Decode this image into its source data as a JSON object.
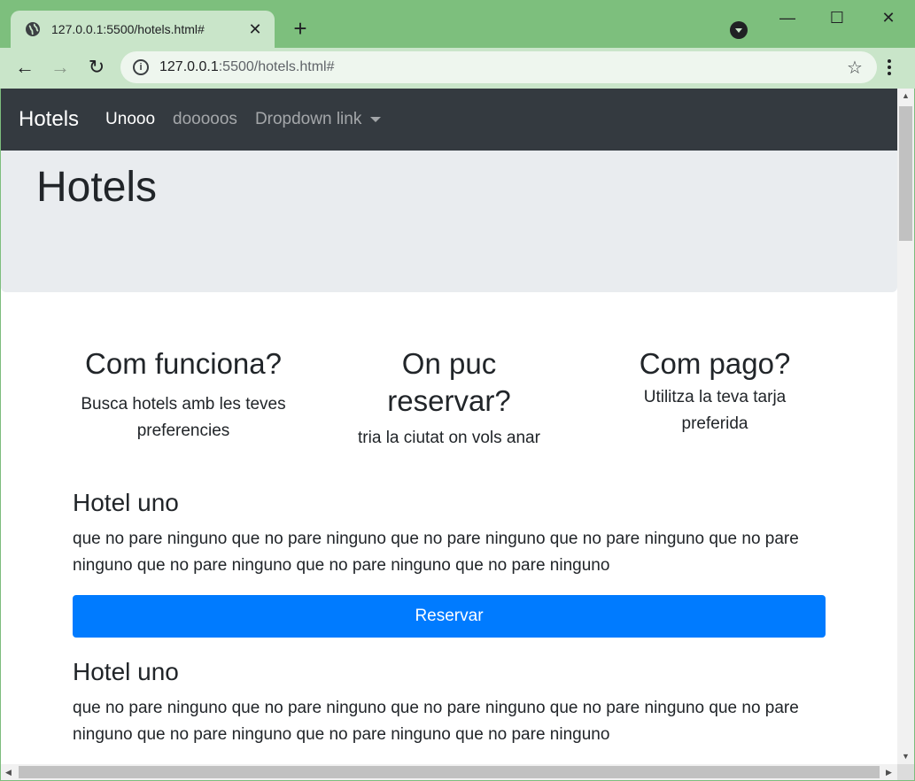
{
  "browser": {
    "tab_title": "127.0.0.1:5500/hotels.html#",
    "tab_close": "✕",
    "new_tab": "+",
    "url_host": "127.0.0.1",
    "url_rest": ":5500/hotels.html#",
    "back": "←",
    "forward": "→",
    "reload": "↻",
    "star": "☆",
    "minimize": "—",
    "maximize": "☐",
    "close": "✕"
  },
  "navbar": {
    "brand": "Hotels",
    "links": [
      "Unooo",
      "dooooos",
      "Dropdown link"
    ]
  },
  "jumbotron": {
    "title": "Hotels"
  },
  "features": [
    {
      "title": "Com funciona?",
      "text": "Busca hotels amb les teves preferencies"
    },
    {
      "title": "On puc reservar?",
      "text": "tria la ciutat on vols anar"
    },
    {
      "title": "Com pago?",
      "text": "Utilitza la teva tarja preferida"
    }
  ],
  "hotels": [
    {
      "name": "Hotel uno",
      "description": "que no pare ninguno que no pare ninguno que no pare ninguno que no pare ninguno que no pare ninguno que no pare ninguno que no pare ninguno que no pare ninguno",
      "button": "Reservar"
    },
    {
      "name": "Hotel uno",
      "description": "que no pare ninguno que no pare ninguno que no pare ninguno que no pare ninguno que no pare ninguno que no pare ninguno que no pare ninguno que no pare ninguno"
    }
  ],
  "colors": {
    "chrome_frame": "#7dbf7d",
    "chrome_toolbar": "#c9e5c9",
    "navbar_bg": "#343a40",
    "jumbotron_bg": "#e9ecef",
    "primary": "#007bff"
  },
  "icons": {
    "tab": "globe-icon",
    "omnibox": "info-icon",
    "bookmark": "star-icon",
    "menu": "more-vert-icon",
    "profile": "profile-dropdown-icon"
  }
}
